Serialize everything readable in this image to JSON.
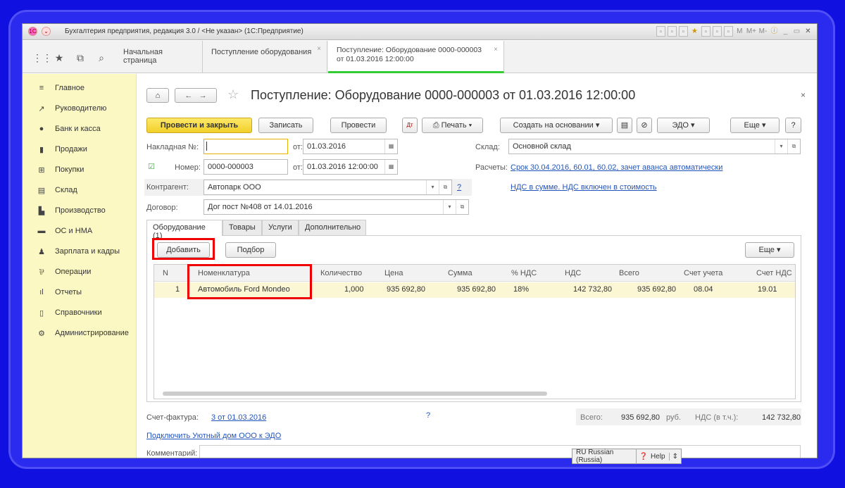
{
  "window": {
    "title": "Бухгалтерия предприятия, редакция 3.0 / <Не указан>  (1С:Предприятие)",
    "tools": [
      "M",
      "M+",
      "M-"
    ]
  },
  "tabs": [
    {
      "label": "Начальная страница"
    },
    {
      "label": "Поступление оборудования"
    },
    {
      "label_line1": "Поступление: Оборудование 0000-000003",
      "label_line2": "от 01.03.2016 12:00:00"
    }
  ],
  "sidebar": {
    "items": [
      {
        "label": "Главное",
        "icon": "menu-icon"
      },
      {
        "label": "Руководителю",
        "icon": "trend-icon"
      },
      {
        "label": "Банк и касса",
        "icon": "coin-icon"
      },
      {
        "label": "Продажи",
        "icon": "bag-icon"
      },
      {
        "label": "Покупки",
        "icon": "cart-icon"
      },
      {
        "label": "Склад",
        "icon": "warehouse-icon"
      },
      {
        "label": "Производство",
        "icon": "factory-icon"
      },
      {
        "label": "ОС и НМА",
        "icon": "truck-icon"
      },
      {
        "label": "Зарплата и кадры",
        "icon": "person-icon"
      },
      {
        "label": "Операции",
        "icon": "operations-icon"
      },
      {
        "label": "Отчеты",
        "icon": "chart-icon"
      },
      {
        "label": "Справочники",
        "icon": "book-icon"
      },
      {
        "label": "Администрирование",
        "icon": "gear-icon"
      }
    ]
  },
  "doc": {
    "title": "Поступление: Оборудование 0000-000003 от 01.03.2016 12:00:00"
  },
  "toolbar": {
    "post_close": "Провести и закрыть",
    "save": "Записать",
    "post": "Провести",
    "print": "Печать",
    "create_based": "Создать на основании",
    "edo": "ЭДО",
    "more": "Еще",
    "help": "?"
  },
  "form": {
    "invoice_label": "Накладная  №:",
    "invoice_value": "",
    "from_label": "от:",
    "invoice_date": "01.03.2016",
    "number_label": "Номер:",
    "number_value": "0000-000003",
    "number_date": "01.03.2016 12:00:00",
    "warehouse_label": "Склад:",
    "warehouse_value": "Основной склад",
    "settlements_label": "Расчеты:",
    "settlements_value": "Срок 30.04.2016, 60.01, 60.02, зачет аванса автоматически",
    "vat_link": "НДС в сумме. НДС включен в стоимость",
    "counterparty_label": "Контрагент:",
    "counterparty_value": "Автопарк ООО",
    "contract_label": "Договор:",
    "contract_value": "Дог пост №408 от 14.01.2016",
    "q": "?"
  },
  "section_tabs": [
    {
      "label": "Оборудование (1)"
    },
    {
      "label": "Товары"
    },
    {
      "label": "Услуги"
    },
    {
      "label": "Дополнительно"
    }
  ],
  "table_toolbar": {
    "add": "Добавить",
    "select": "Подбор",
    "more": "Еще"
  },
  "table": {
    "headers": [
      "N",
      "Номенклатура",
      "Количество",
      "Цена",
      "Сумма",
      "% НДС",
      "НДС",
      "Всего",
      "Счет учета",
      "Счет НДС"
    ],
    "rows": [
      [
        "1",
        "Автомобиль Ford Mondeo",
        "1,000",
        "935 692,80",
        "935 692,80",
        "18%",
        "142 732,80",
        "935 692,80",
        "08.04",
        "19.01"
      ]
    ]
  },
  "footer": {
    "invoice_label": "Счет-фактура:",
    "invoice_link": "3 от 01.03.2016",
    "q": "?",
    "total_label": "Всего:",
    "total_value": "935 692,80",
    "currency": "руб.",
    "vat_label": "НДС (в т.ч.):",
    "vat_value": "142 732,80",
    "edo_link": "Подключить Уютный дом ООО к ЭДО",
    "comment_label": "Комментарий:"
  },
  "statusbar": {
    "lang": "RU Russian (Russia)",
    "help": "Help"
  },
  "colors": {
    "accent_yellow": "#f2cf2a",
    "sidebar_bg": "#fbf8c4",
    "highlight_red": "#ee0000",
    "active_tab_green": "#33cc33",
    "link_blue": "#2255bb"
  }
}
